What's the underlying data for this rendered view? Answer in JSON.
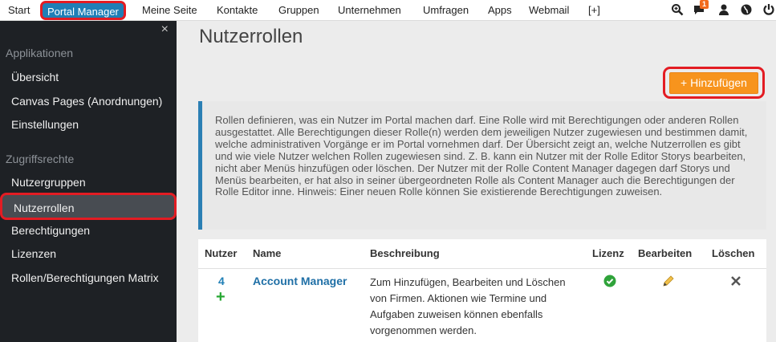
{
  "topnav": {
    "items": [
      "Start",
      "Portal Manager",
      "Meine Seite",
      "Kontakte",
      "Gruppen",
      "Unternehmen",
      "Umfragen",
      "Apps",
      "Webmail",
      "[+]"
    ],
    "active": "Portal Manager",
    "notification_count": "1",
    "icons": [
      "search-zoom-icon",
      "chat-bubble-icon",
      "user-icon",
      "globe-icon",
      "power-icon"
    ]
  },
  "sidebar": {
    "close": "×",
    "section_applications": "Applikationen",
    "applications": [
      "Übersicht",
      "Canvas Pages (Anordnungen)",
      "Einstellungen"
    ],
    "section_access": "Zugriffsrechte",
    "access": [
      "Nutzergruppen",
      "Nutzerrollen",
      "Berechtigungen",
      "Lizenzen",
      "Rollen/Berechtigungen Matrix"
    ],
    "active": "Nutzerrollen"
  },
  "main": {
    "title": "Nutzerrollen",
    "add_button": "+ Hinzufügen",
    "info_text": "Rollen definieren, was ein Nutzer im Portal machen darf. Eine Rolle wird mit Berechtigungen oder anderen Rollen ausgestattet. Alle Berechtigungen dieser Rolle(n) werden dem jeweiligen Nutzer zugewiesen und bestimmen damit, welche administrativen Vorgänge er im Portal vornehmen darf. Der Übersicht zeigt an, welche Nutzerrollen es gibt und wie viele Nutzer welchen Rollen zugewiesen sind. Z. B. kann ein Nutzer mit der Rolle Editor Storys bearbeiten, nicht aber Menüs hinzufügen oder löschen. Der Nutzer mit der Rolle Content Manager dagegen darf Storys und Menüs bearbeiten, er hat also in seiner übergeordneten Rolle als Content Manager auch die Berechtigungen der Rolle Editor inne. Hinweis: Einer neuen Rolle können Sie existierende Berechtigungen zuweisen."
  },
  "table": {
    "headers": [
      "Nutzer",
      "Name",
      "Beschreibung",
      "Lizenz",
      "Bearbeiten",
      "Löschen"
    ],
    "rows": [
      {
        "count": "4",
        "add_symbol": "+",
        "name": "Account Manager",
        "description": "Zum Hinzufügen, Bearbeiten und Löschen von Firmen. Aktionen wie Termine und Aufgaben zuweisen können ebenfalls vorgenommen werden."
      }
    ]
  },
  "colors": {
    "accent_blue": "#1f7fb6",
    "highlight_red": "#e31c23",
    "button_orange": "#f7941d",
    "sidebar_bg": "#1e2125"
  }
}
